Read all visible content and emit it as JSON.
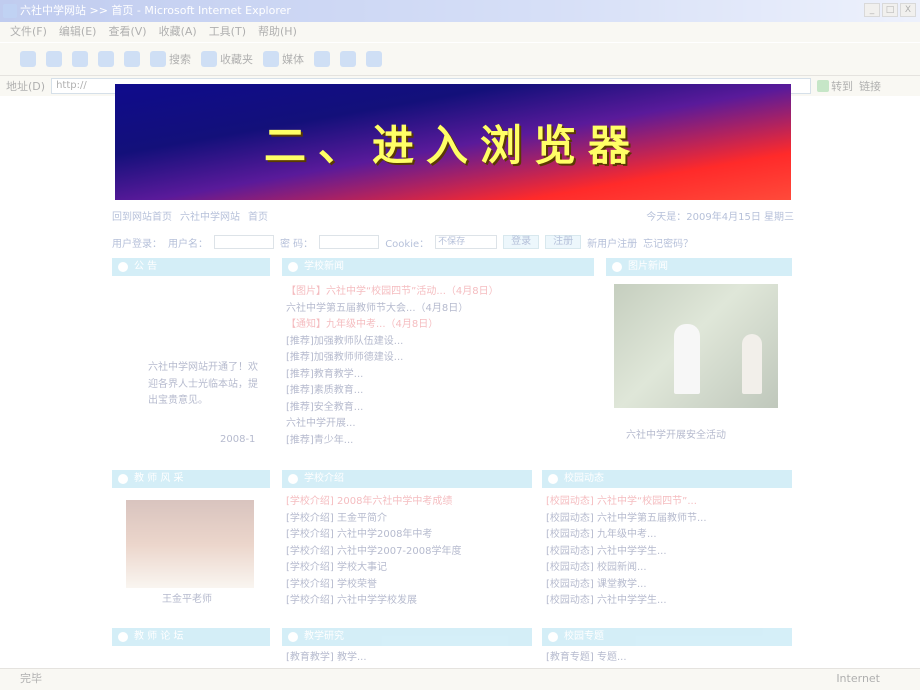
{
  "window": {
    "title": "六社中学网站 >> 首页 - Microsoft Internet Explorer",
    "controls": [
      "_",
      "□",
      "X"
    ]
  },
  "menu": [
    "文件(F)",
    "编辑(E)",
    "查看(V)",
    "收藏(A)",
    "工具(T)",
    "帮助(H)"
  ],
  "toolbar": {
    "search": "搜索",
    "favorites": "收藏夹",
    "media": "媒体"
  },
  "address": {
    "label": "地址(D)",
    "url": "http://",
    "go": "转到",
    "links": "链接"
  },
  "banner": {
    "title": "二、进入浏览器"
  },
  "nav": {
    "home": "回到网站首页",
    "site": "六社中学网站",
    "page": "首页",
    "date": "今天是：2009年4月15日 星期三"
  },
  "login": {
    "user_label": "用户登录：",
    "name_label": "用户名：",
    "pwd_label": "密 码：",
    "code_label": "Cookie：",
    "select": "不保存",
    "btn1": "登录",
    "btn2": "注册",
    "reg": "新用户注册",
    "forgot": "忘记密码？"
  },
  "panels": {
    "notice": "公 告",
    "news": "学校新闻",
    "image": "图片新闻",
    "teacher": "教 师 风 采",
    "intro": "学校介绍",
    "news2": "校园动态",
    "col7": "教 师 论 坛",
    "col8": "教学研究",
    "col9": "校园专题"
  },
  "notice": {
    "text": "六社中学网站开通了！欢迎各界人士光临本站，提出宝贵意见。",
    "date": "2008-1"
  },
  "news_list": [
    "【图片】六社中学“校园四节”活动...（4月8日）",
    "六社中学第五届教师节大会...（4月8日）",
    "【通知】九年级中考...（4月8日）",
    "[推荐]加强教师队伍建设...",
    "[推荐]加强教师师德建设...",
    "[推荐]教育教学...",
    "[推荐]素质教育...",
    "[推荐]安全教育...",
    "六社中学开展...",
    "[推荐]青少年..."
  ],
  "image_caption": "六社中学开展安全活动",
  "teacher_caption": "王金平老师",
  "intro_list": [
    "[学校介绍] 2008年六社中学中考成绩",
    "[学校介绍] 王金平简介",
    "[学校介绍] 六社中学2008年中考",
    "[学校介绍] 六社中学2007-2008学年度",
    "[学校介绍] 学校大事记",
    "[学校介绍] 学校荣誉",
    "[学校介绍] 六社中学学校发展"
  ],
  "news2_list": [
    "[校园动态] 六社中学“校园四节”...",
    "[校园动态] 六社中学第五届教师节...",
    "[校园动态] 九年级中考...",
    "[校园动态] 六社中学学生...",
    "[校园动态] 校园新闻...",
    "[校园动态] 课堂教学...",
    "[校园动态] 六社中学学生..."
  ],
  "col8_item": "[教育教学] 教学...",
  "col9_item": "[教育专题] 专题...",
  "status": {
    "left": "完毕",
    "zone": "Internet"
  },
  "colors": {
    "banner_top": "#0f0b8c",
    "banner_bottom": "#ff2a2a",
    "title": "#ffff66"
  }
}
